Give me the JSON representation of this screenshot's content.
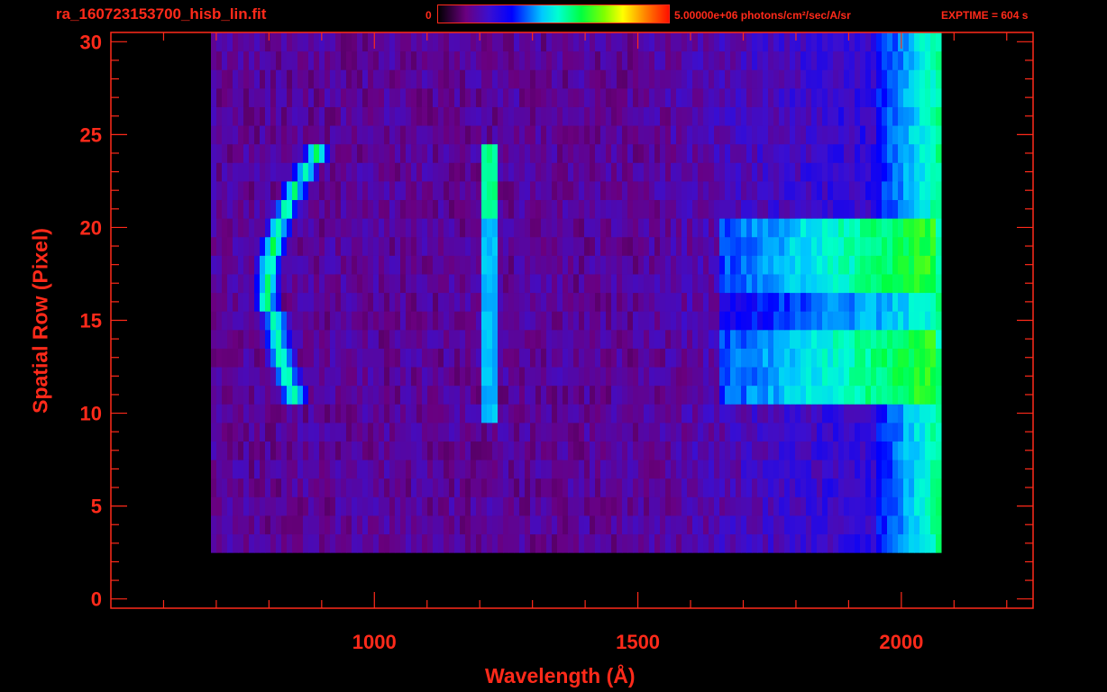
{
  "header": {
    "title": "ra_160723153700_hisb_lin.fit",
    "colorbar_min": "0",
    "colorbar_units": "5.00000e+06 photons/cm²/sec/A/sr",
    "exptime": "EXPTIME = 604 s"
  },
  "colors": {
    "axis": "#ff2a1a",
    "background": "#000000"
  },
  "chart_data": {
    "type": "heatmap",
    "title": "ra_160723153700_hisb_lin.fit",
    "xlabel": "Wavelength (Å)",
    "ylabel": "Spatial Row (Pixel)",
    "xlim": [
      500,
      2250
    ],
    "ylim": [
      -0.5,
      30.5
    ],
    "x_ticks": [
      1000,
      1500,
      2000
    ],
    "y_ticks": [
      0,
      5,
      10,
      15,
      20,
      25,
      30
    ],
    "colorbar": {
      "min": 0,
      "max": 5000000,
      "units": "photons/cm²/sec/A/sr"
    },
    "data_extent": {
      "wavelength": [
        680,
        2070
      ],
      "rows": [
        3,
        30
      ]
    },
    "features": [
      {
        "name": "arc",
        "wavelength": [
          780,
          930
        ],
        "rows": [
          11,
          24
        ],
        "level": 0.55
      },
      {
        "name": "line",
        "wavelength": 1216,
        "rows": [
          10,
          24
        ],
        "level": 0.5
      },
      {
        "name": "band",
        "wavelength": [
          1650,
          2065
        ],
        "rows": [
          11,
          20
        ],
        "level": 0.55
      },
      {
        "name": "edge",
        "wavelength": [
          1950,
          2070
        ],
        "rows": [
          0,
          30
        ],
        "level": 0.5
      }
    ]
  }
}
